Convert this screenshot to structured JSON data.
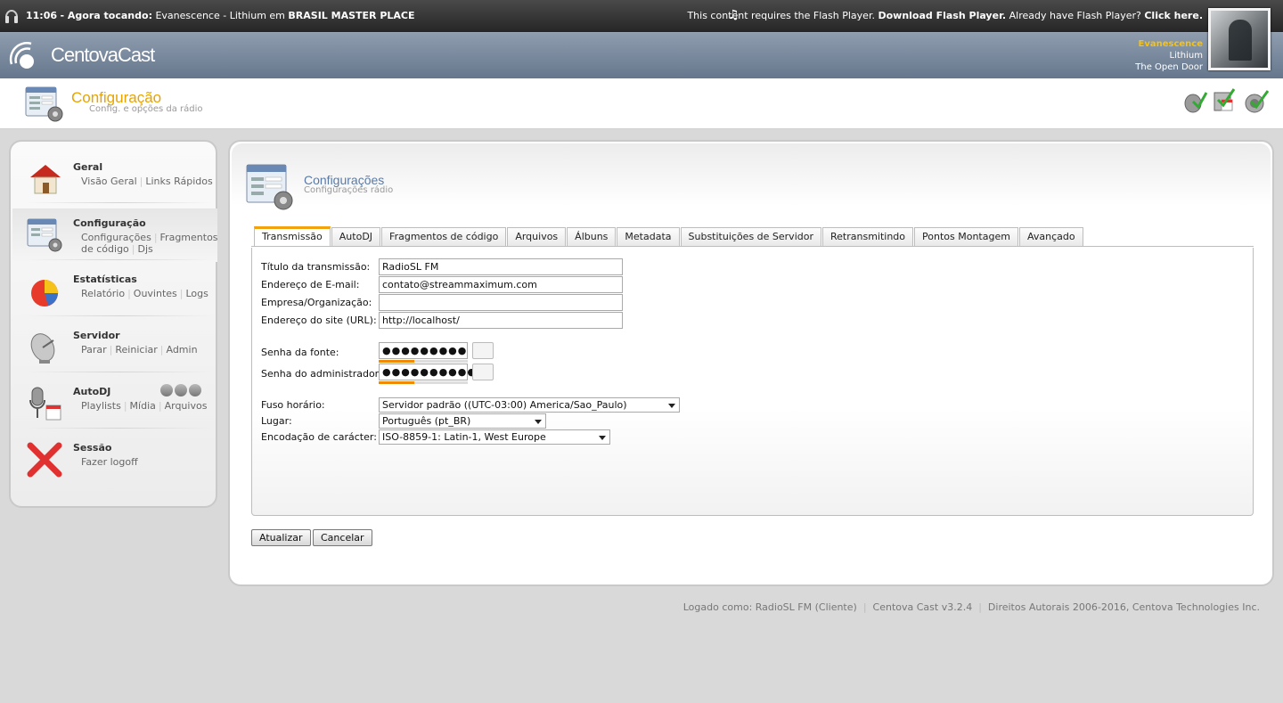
{
  "topbar": {
    "time": "11:06",
    "now_playing_label": "Agora tocando:",
    "now_playing_track": "Evanescence - Lithium em",
    "station": "BRASIL MASTER PLACE",
    "flash_msg": "This content requires the Flash Player.",
    "flash_download": "Download Flash Player.",
    "flash_have": "Already have Flash Player?",
    "flash_click": "Click here."
  },
  "header": {
    "logo": "CentovaCast",
    "artist": "Evanescence",
    "title": "Lithium",
    "album": "The Open Door"
  },
  "page": {
    "title": "Configuração",
    "subtitle": "Config. e opções da rádio"
  },
  "sidebar": {
    "geral": {
      "title": "Geral",
      "links": [
        "Visão Geral",
        "Links Rápidos"
      ]
    },
    "config": {
      "title": "Configuração",
      "links": [
        "Configurações",
        "Fragmentos de código",
        "Djs"
      ]
    },
    "stats": {
      "title": "Estatísticas",
      "links": [
        "Relatório",
        "Ouvintes",
        "Logs"
      ]
    },
    "server": {
      "title": "Servidor",
      "links": [
        "Parar",
        "Reiniciar",
        "Admin"
      ]
    },
    "autodj": {
      "title": "AutoDJ",
      "links": [
        "Playlists",
        "Mídia",
        "Arquivos"
      ]
    },
    "session": {
      "title": "Sessão",
      "links": [
        "Fazer logoff"
      ]
    }
  },
  "main": {
    "title": "Configurações",
    "subtitle": "Configurações rádio",
    "tabs": [
      "Transmissão",
      "AutoDJ",
      "Fragmentos de código",
      "Arquivos",
      "Álbuns",
      "Metadata",
      "Substituições de Servidor",
      "Retransmitindo",
      "Pontos Montagem",
      "Avançado"
    ]
  },
  "form": {
    "title_label": "Título da transmissão:",
    "title_value": "RadioSL FM",
    "email_label": "Endereço de E-mail:",
    "email_value": "contato@streammaximum.com",
    "org_label": "Empresa/Organização:",
    "org_value": "",
    "url_label": "Endereço do site (URL):",
    "url_value": "http://localhost/",
    "source_pw_label": "Senha da fonte:",
    "source_pw_value": "●●●●●●●●●",
    "admin_pw_label": "Senha do administrador:",
    "admin_pw_value": "●●●●●●●●●●●",
    "tz_label": "Fuso horário:",
    "tz_value": "Servidor padrão ((UTC-03:00) America/Sao_Paulo)",
    "locale_label": "Lugar:",
    "locale_value": "Português (pt_BR)",
    "charset_label": "Encodação de carácter:",
    "charset_value": "ISO-8859-1: Latin-1, West Europe"
  },
  "buttons": {
    "update": "Atualizar",
    "cancel": "Cancelar"
  },
  "footer": {
    "logged": "Logado como: RadioSL FM (Cliente)",
    "version": "Centova Cast v3.2.4",
    "copyright": "Direitos Autorais 2006-2016, Centova Technologies Inc."
  }
}
